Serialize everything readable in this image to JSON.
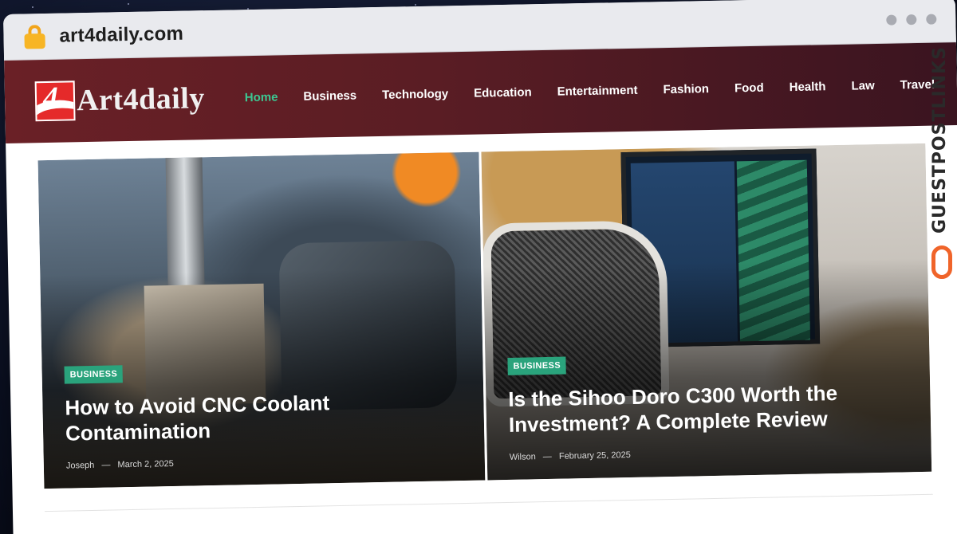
{
  "browser": {
    "url": "art4daily.com"
  },
  "site": {
    "logo_number": "4",
    "logo_text": "Art4daily"
  },
  "nav": [
    {
      "label": "Home",
      "active": true
    },
    {
      "label": "Business"
    },
    {
      "label": "Technology"
    },
    {
      "label": "Education"
    },
    {
      "label": "Entertainment"
    },
    {
      "label": "Fashion"
    },
    {
      "label": "Food"
    },
    {
      "label": "Health"
    },
    {
      "label": "Law"
    },
    {
      "label": "Travel"
    }
  ],
  "hero": [
    {
      "category": "BUSINESS",
      "title": "How to Avoid CNC Coolant Contamination",
      "author": "Joseph",
      "separator": "—",
      "date": "March 2, 2025"
    },
    {
      "category": "BUSINESS",
      "title": "Is the Sihoo Doro C300 Worth the Investment? A Complete Review",
      "author": "Wilson",
      "separator": "—",
      "date": "February 25, 2025"
    }
  ],
  "watermark": {
    "text": "GUESTPOSTLINKS"
  },
  "colors": {
    "header_bg": "#5a1d24",
    "nav_active": "#3cc792",
    "badge": "#2aa37c",
    "lock": "#f7b525",
    "watermark_icon": "#f0642a"
  }
}
